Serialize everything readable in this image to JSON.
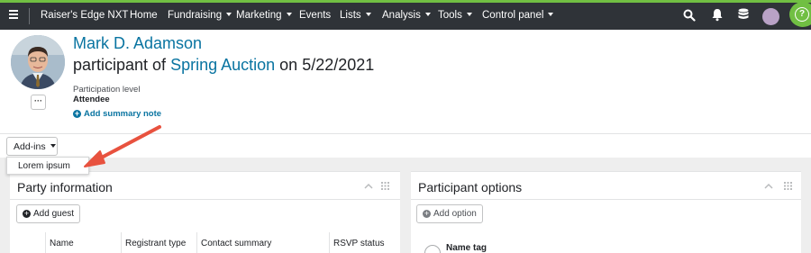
{
  "app": {
    "name": "Raiser's Edge NXT"
  },
  "nav": {
    "items": [
      {
        "label": "Home",
        "dropdown": false
      },
      {
        "label": "Fundraising",
        "dropdown": true
      },
      {
        "label": "Marketing",
        "dropdown": true
      },
      {
        "label": "Events",
        "dropdown": false
      },
      {
        "label": "Lists",
        "dropdown": true
      },
      {
        "label": "Analysis",
        "dropdown": true
      },
      {
        "label": "Tools",
        "dropdown": true
      },
      {
        "label": "Control panel",
        "dropdown": true
      }
    ],
    "icons": [
      "menu-icon",
      "search-icon",
      "bell-icon",
      "database-icon",
      "user-avatar",
      "help-icon"
    ],
    "help_label": "?"
  },
  "record": {
    "name": "Mark D. Adamson",
    "subtitle_prefix": "participant of",
    "event": "Spring Auction",
    "subtitle_suffix": "on 5/22/2021",
    "participation_label": "Participation level",
    "participation_value": "Attendee",
    "add_note": "Add summary note",
    "more_label": "···"
  },
  "addins": {
    "button_label": "Add-ins",
    "menu_items": [
      "Lorem ipsum"
    ]
  },
  "party_panel": {
    "title": "Party information",
    "add_button": "Add guest",
    "columns": [
      "Name",
      "Registrant type",
      "Contact summary",
      "RSVP status"
    ]
  },
  "options_panel": {
    "title": "Participant options",
    "add_button": "Add option",
    "first_option": "Name tag"
  },
  "colors": {
    "nav_bg": "#2f3338",
    "accent_green": "#71bf43",
    "link_blue": "#0974a1",
    "annotation_red": "#e8523f"
  }
}
